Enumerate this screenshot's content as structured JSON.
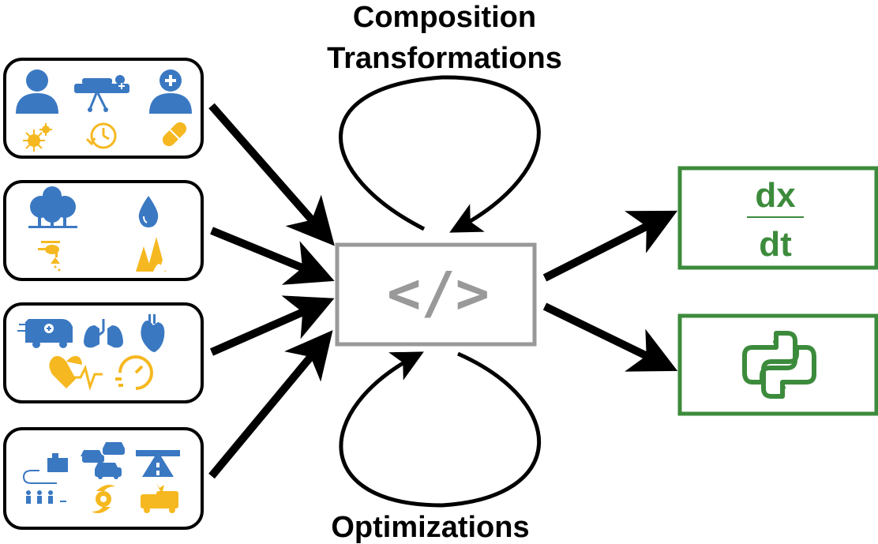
{
  "labels": {
    "top_line1": "Composition",
    "top_line2": "Transformations",
    "bottom": "Optimizations"
  },
  "center_box": {
    "symbol": "</>"
  },
  "outputs": {
    "derivative": {
      "numerator": "dx",
      "denominator": "dt"
    },
    "python_icon": "python-logo-icon"
  },
  "input_panels": [
    {
      "name": "healthcare",
      "icons": [
        "person-icon",
        "stretcher-icon",
        "doctor-icon",
        "virus-icon",
        "timer-icon",
        "pill-icon"
      ]
    },
    {
      "name": "environment",
      "icons": [
        "trees-icon",
        "water-drop-icon",
        "helicopter-icon",
        "wildfire-icon"
      ]
    },
    {
      "name": "cardiology",
      "icons": [
        "ambulance-icon",
        "lungs-icon",
        "heart-icon",
        "heartbeat-icon",
        "speedometer-icon"
      ]
    },
    {
      "name": "transportation",
      "icons": [
        "route-icon",
        "traffic-icon",
        "highway-icon",
        "crowd-icon",
        "hurricane-icon",
        "car-crash-icon"
      ]
    }
  ],
  "colors": {
    "blue": "#3a78c2",
    "yellow": "#f5b820",
    "green": "#3c8b3c",
    "gray": "#999999",
    "black": "#000000"
  }
}
